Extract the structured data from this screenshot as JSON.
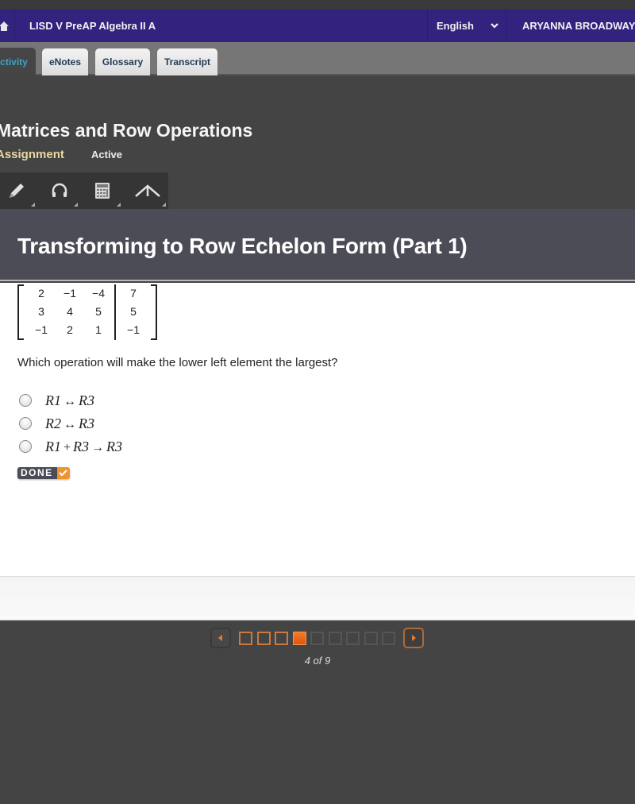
{
  "topbar": {
    "course_title": "LISD V PreAP Algebra II A",
    "language": "English",
    "user_name": "ARYANNA BROADWAY"
  },
  "tabs": [
    {
      "label": "ctivity",
      "active": true
    },
    {
      "label": "eNotes",
      "active": false
    },
    {
      "label": "Glossary",
      "active": false
    },
    {
      "label": "Transcript",
      "active": false
    }
  ],
  "lesson": {
    "title": "Matrices and Row Operations",
    "type": "Assignment",
    "status": "Active"
  },
  "tools": [
    {
      "name": "pencil-icon"
    },
    {
      "name": "headphones-icon"
    },
    {
      "name": "calculator-icon"
    },
    {
      "name": "reference-icon"
    }
  ],
  "banner": {
    "title": "Transforming to Row Echelon Form (Part 1)"
  },
  "matrix": {
    "rows": [
      [
        "2",
        "−1",
        "−4",
        "7"
      ],
      [
        "3",
        "4",
        "5",
        "5"
      ],
      [
        "−1",
        "2",
        "1",
        "−1"
      ]
    ]
  },
  "question": {
    "text": "Which operation will make the lower left element the largest?",
    "options": [
      {
        "parts": [
          "R1",
          "↔",
          "R3"
        ],
        "selected": false
      },
      {
        "parts": [
          "R2",
          "↔",
          "R3"
        ],
        "selected": false
      },
      {
        "parts": [
          "R1",
          "+",
          "R3",
          "→",
          "R3"
        ],
        "selected": false
      }
    ],
    "done_label": "DONE"
  },
  "pagination": {
    "current": 4,
    "total": 9,
    "label": "4 of 9",
    "visited": [
      1,
      2,
      3
    ]
  },
  "colors": {
    "topbar": "#33237f",
    "accent_orange": "#f37a25",
    "banner": "#4b4c55"
  }
}
